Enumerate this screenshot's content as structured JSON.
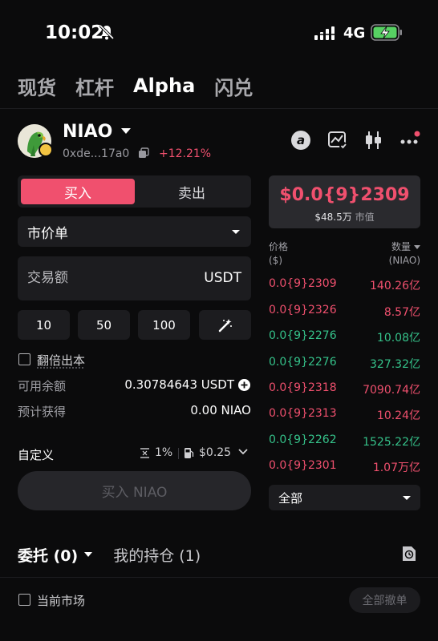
{
  "status": {
    "time": "10:02",
    "network": "4G"
  },
  "tabs": [
    "现货",
    "杠杆",
    "Alpha",
    "闪兑"
  ],
  "token": {
    "name": "NIAO",
    "address": "0xde...17a0",
    "change": "+12.21%"
  },
  "order_side": {
    "buy": "买入",
    "sell": "卖出"
  },
  "order_type": "市价单",
  "amount": {
    "placeholder": "交易额",
    "unit": "USDT"
  },
  "quick_amounts": [
    "10",
    "50",
    "100"
  ],
  "double_sell": "翻倍出本",
  "available": {
    "label": "可用余额",
    "value": "0.30784643 USDT"
  },
  "estimated": {
    "label": "预计获得",
    "value": "0.00 NIAO"
  },
  "custom": {
    "label": "自定义",
    "slippage": "1%",
    "gas": "$0.25"
  },
  "submit_label": "买入 NIAO",
  "price": {
    "value": "$0.0{9}2309",
    "market_cap": "$48.5万",
    "market_cap_label": "市值"
  },
  "orderbook": {
    "price_header": "价格",
    "price_unit": "($)",
    "qty_header": "数量",
    "qty_unit": "(NIAO)",
    "rows": [
      {
        "price": "0.0{9}2309",
        "qty": "140.26亿",
        "side": "sell"
      },
      {
        "price": "0.0{9}2326",
        "qty": "8.57亿",
        "side": "sell"
      },
      {
        "price": "0.0{9}2276",
        "qty": "10.08亿",
        "side": "buy"
      },
      {
        "price": "0.0{9}2276",
        "qty": "327.32亿",
        "side": "buy"
      },
      {
        "price": "0.0{9}2318",
        "qty": "7090.74亿",
        "side": "sell"
      },
      {
        "price": "0.0{9}2313",
        "qty": "10.24亿",
        "side": "sell"
      },
      {
        "price": "0.0{9}2262",
        "qty": "1525.22亿",
        "side": "buy"
      },
      {
        "price": "0.0{9}2301",
        "qty": "1.07万亿",
        "side": "sell"
      }
    ],
    "filter": "全部"
  },
  "bottom": {
    "orders_tab": "委托 (0)",
    "positions_tab": "我的持仓 (1)",
    "current_market": "当前市场",
    "cancel_all": "全部撤单"
  },
  "colors": {
    "buy_red": "#f0506e",
    "up_green": "#35c28a",
    "background": "#0b0b0c"
  },
  "icons": [
    "bell-slash-icon",
    "signal-icon",
    "battery-charging-icon",
    "copy-icon",
    "alpha-icon",
    "chart-icon",
    "candlestick-icon",
    "more-icon",
    "magic-wand-icon",
    "plus-icon",
    "slippage-icon",
    "gas-icon",
    "chevron-down-icon",
    "document-icon"
  ]
}
